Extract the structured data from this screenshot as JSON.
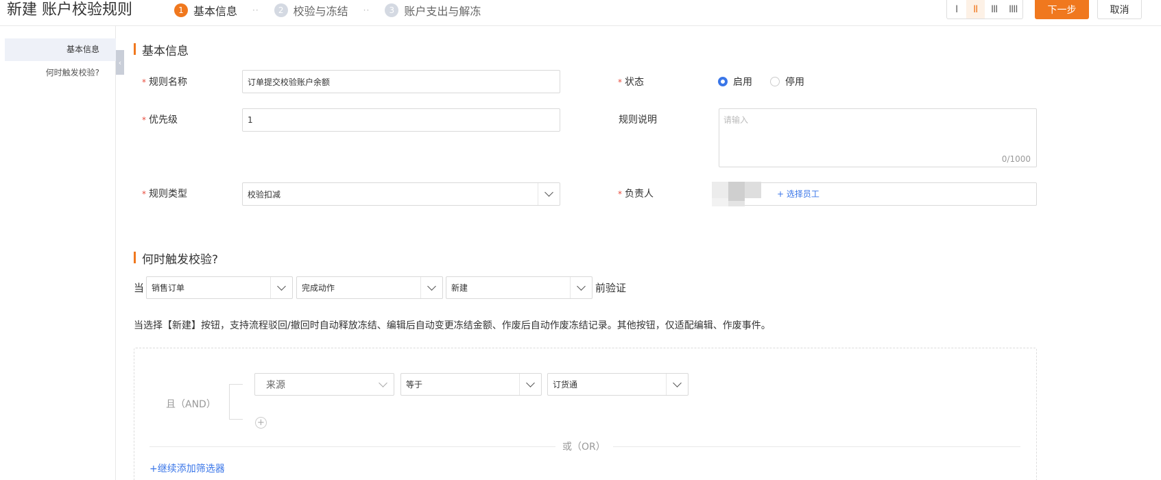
{
  "header": {
    "title": "新建 账户校验规则",
    "steps": [
      {
        "num": "1",
        "label": "基本信息"
      },
      {
        "num": "2",
        "label": "校验与冻结"
      },
      {
        "num": "3",
        "label": "账户支出与解冻"
      }
    ],
    "step_sep": "··",
    "layouts": [
      "I",
      "II",
      "III",
      "IIII"
    ],
    "next_label": "下一步",
    "cancel_label": "取消",
    "accent_color": "#f0781e"
  },
  "nav": {
    "items": [
      "基本信息",
      "何时触发校验?"
    ],
    "collapse_icon": "‹"
  },
  "basic": {
    "section_title": "基本信息",
    "required_mark": "*",
    "rule_name_label": "规则名称",
    "rule_name_value": "订单提交校验账户余额",
    "status_label": "状态",
    "status_options": [
      "启用",
      "停用"
    ],
    "status_selected": "启用",
    "priority_label": "优先级",
    "priority_value": "1",
    "desc_label": "规则说明",
    "desc_placeholder": "请输入",
    "desc_counter": "0/1000",
    "type_label": "规则类型",
    "type_value": "校验扣减",
    "owner_label": "负责人",
    "owner_action": "+ 选择员工"
  },
  "trigger": {
    "section_title": "何时触发校验?",
    "prefix": "当",
    "object_value": "销售订单",
    "action_value": "完成动作",
    "button_value": "新建",
    "suffix": "前验证",
    "hint": "当选择【新建】按钮，支持流程驳回/撤回时自动释放冻结、编辑后自动变更冻结金额、作废后自动作废冻结记录。其他按钮，仅适配编辑、作废事件。",
    "and_label": "且（AND）",
    "field_value": "来源",
    "operator_value": "等于",
    "compare_value": "订货通",
    "add_icon": "+",
    "or_label": "或（OR）",
    "add_filter_label": "+继续添加筛选器"
  }
}
